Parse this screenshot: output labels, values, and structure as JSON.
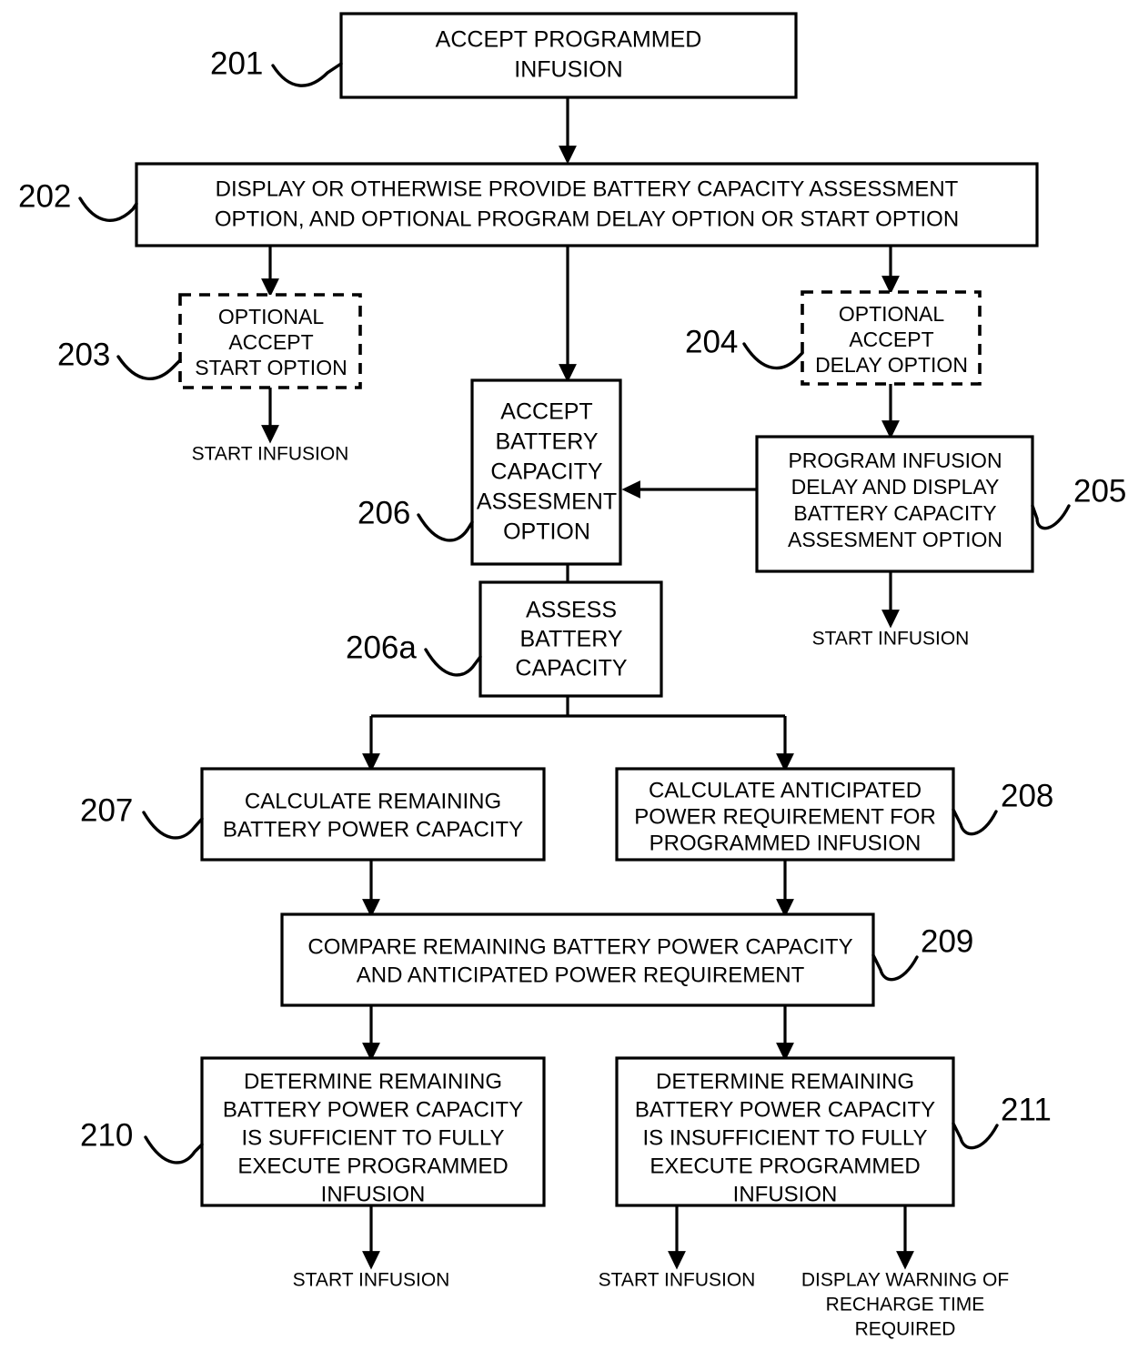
{
  "figure": {
    "title": "Battery capacity assessment infusion flowchart",
    "nodes": [
      {
        "ref": "201",
        "style": "solid",
        "lines": [
          "ACCEPT PROGRAMMED",
          "INFUSION"
        ]
      },
      {
        "ref": "202",
        "style": "solid",
        "lines": [
          "DISPLAY OR OTHERWISE PROVIDE BATTERY CAPACITY ASSESSMENT",
          "OPTION, AND OPTIONAL PROGRAM DELAY OPTION OR START OPTION"
        ]
      },
      {
        "ref": "203",
        "style": "dashed",
        "lines": [
          "OPTIONAL",
          "ACCEPT",
          "START OPTION"
        ]
      },
      {
        "ref": "204",
        "style": "dashed",
        "lines": [
          "OPTIONAL",
          "ACCEPT",
          "DELAY OPTION"
        ]
      },
      {
        "ref": "205",
        "style": "solid",
        "lines": [
          "PROGRAM INFUSION",
          "DELAY AND DISPLAY",
          "BATTERY CAPACITY",
          "ASSESMENT OPTION"
        ]
      },
      {
        "ref": "206",
        "style": "solid",
        "lines": [
          "ACCEPT",
          "BATTERY",
          "CAPACITY",
          "ASSESMENT",
          "OPTION"
        ]
      },
      {
        "ref": "206a",
        "style": "solid",
        "lines": [
          "ASSESS",
          "BATTERY",
          "CAPACITY"
        ]
      },
      {
        "ref": "207",
        "style": "solid",
        "lines": [
          "CALCULATE REMAINING",
          "BATTERY POWER CAPACITY"
        ]
      },
      {
        "ref": "208",
        "style": "solid",
        "lines": [
          "CALCULATE ANTICIPATED",
          "POWER REQUIREMENT FOR",
          "PROGRAMMED INFUSION"
        ]
      },
      {
        "ref": "209",
        "style": "solid",
        "lines": [
          "COMPARE REMAINING BATTERY POWER CAPACITY",
          "AND ANTICIPATED POWER REQUIREMENT"
        ]
      },
      {
        "ref": "210",
        "style": "solid",
        "lines": [
          "DETERMINE REMAINING",
          "BATTERY POWER CAPACITY",
          "IS SUFFICIENT TO FULLY",
          "EXECUTE PROGRAMMED",
          "INFUSION"
        ]
      },
      {
        "ref": "211",
        "style": "solid",
        "lines": [
          "DETERMINE REMAINING",
          "BATTERY POWER CAPACITY",
          "IS INSUFFICIENT TO FULLY",
          "EXECUTE PROGRAMMED",
          "INFUSION"
        ]
      }
    ],
    "terminals": [
      {
        "id": "start-infusion-203",
        "lines": [
          "START INFUSION"
        ]
      },
      {
        "id": "start-infusion-205",
        "lines": [
          "START INFUSION"
        ]
      },
      {
        "id": "start-infusion-210",
        "lines": [
          "START INFUSION"
        ]
      },
      {
        "id": "start-infusion-211",
        "lines": [
          "START INFUSION"
        ]
      },
      {
        "id": "display-warning",
        "lines": [
          "DISPLAY WARNING OF",
          "RECHARGE TIME",
          "REQUIRED"
        ]
      }
    ],
    "colors": {
      "stroke": "#000000",
      "fill": "#ffffff",
      "text": "#000000"
    }
  }
}
